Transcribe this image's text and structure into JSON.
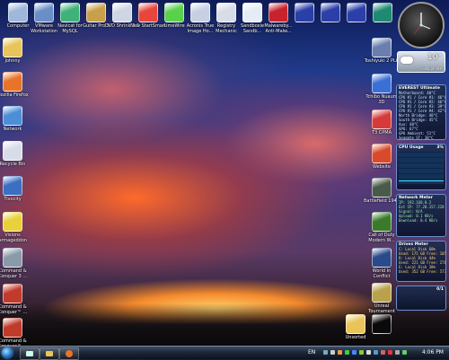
{
  "desktop": {
    "top_icons": [
      {
        "label": "Computer",
        "icon": "computer-icon",
        "color": "#9fb7d8"
      },
      {
        "label": "VMware Workstation",
        "icon": "vmware-icon",
        "color": "#6a8fc6"
      },
      {
        "label": "Navicat for MySQL",
        "icon": "navicat-icon",
        "color": "#3fb27a"
      },
      {
        "label": "Guitar Pro 5",
        "icon": "guitar-pro-icon",
        "color": "#c9a04a"
      },
      {
        "label": "DVD Shrink 3.2",
        "icon": "dvd-shrink-icon",
        "color": "#cfd6e3"
      },
      {
        "label": "New StartSmart",
        "icon": "startsmart-icon",
        "color": "#e8463c"
      },
      {
        "label": "LimeWire",
        "icon": "limewire-icon",
        "color": "#5ad14b"
      },
      {
        "label": "Acronis True Image Ho...",
        "icon": "acronis-icon",
        "color": "#c7d0e2"
      },
      {
        "label": "Registry Mechanic",
        "icon": "registry-mechanic-icon",
        "color": "#d8dce6"
      },
      {
        "label": "Sandboxie Sandb...",
        "icon": "sandboxie-icon",
        "color": "#e6ecf5"
      },
      {
        "label": "Malwareby... Anti-Malw...",
        "icon": "malwarebytes-icon",
        "color": "#c8232c"
      },
      {
        "label": "",
        "icon": "mc-icon",
        "color": "#2b3fa8"
      },
      {
        "label": "",
        "icon": "mc-icon",
        "color": "#2b3fa8"
      },
      {
        "label": "",
        "icon": "mc-icon",
        "color": "#2b3fa8"
      },
      {
        "label": "",
        "icon": "p-app-icon",
        "color": "#1f8a72"
      }
    ],
    "left_icons": [
      {
        "label": "Johnny",
        "icon": "user-folder-icon",
        "color": "#e8c45a"
      },
      {
        "label": "Mozilla Firefox",
        "icon": "firefox-icon",
        "color": "#e8742a"
      },
      {
        "label": "Network",
        "icon": "network-icon",
        "color": "#4d8fd6"
      },
      {
        "label": "Recycle Bin",
        "icon": "recycle-bin-icon",
        "color": "#d7dde8"
      },
      {
        "label": "Tivocity",
        "icon": "tivocity-icon",
        "color": "#3a6fc2"
      },
      {
        "label": "Visions Armageddon",
        "icon": "radiation-icon",
        "color": "#e8d13a"
      },
      {
        "label": "Command & Conquer 3 ...",
        "icon": "cnc-icon",
        "color": "#8a9aa8"
      },
      {
        "label": "Command & Conquer™ ...",
        "icon": "cnc-red-icon",
        "color": "#c23a2a"
      },
      {
        "label": "Command & Conquer™ ...",
        "icon": "cnc-red-icon",
        "color": "#c23a2a"
      }
    ],
    "right_icons": [
      {
        "label": "Toshiyuki 2 PLC",
        "icon": "ts-icon",
        "color": "#6a7fb0"
      },
      {
        "label": "Tchibo Nuaum 3D",
        "icon": "tchibo-icon",
        "color": "#3a6fd6"
      },
      {
        "label": "T3 CPMA",
        "icon": "cpma-icon",
        "color": "#d63a3a"
      },
      {
        "label": "Website",
        "icon": "website-icon",
        "color": "#d84a2a"
      },
      {
        "label": "Battlefield 1942",
        "icon": "battlefield-icon",
        "color": "#4a5a4a"
      },
      {
        "label": "Call of Duty Modern W...",
        "icon": "cod-icon",
        "color": "#3a7a2a"
      },
      {
        "label": "World In Conflict",
        "icon": "wic-icon",
        "color": "#2a4a8a"
      },
      {
        "label": "Unreal Tournament",
        "icon": "ut-icon",
        "color": "#b8a24a"
      },
      {
        "label": "Unsorted",
        "icon": "folder-icon",
        "color": "#e8c45a"
      },
      {
        "label": "",
        "icon": "black-window-icon",
        "color": "#0a0a0a"
      }
    ]
  },
  "gadgets": {
    "weather": {
      "temp": "10°",
      "city": "Skopje, MK"
    },
    "everest": {
      "title": "EVEREST Ultimate",
      "lines": [
        "Motherboard: 40°C",
        "CPU #1 / Core #1: 46°C",
        "CPU #1 / Core #2: 46°C",
        "CPU #1 / Core #3: 39°C",
        "CPU #1 / Core #4: 42°C",
        "North Bridge: 48°C",
        "South Bridge: 45°C",
        "Aux: 40°C",
        "GPU: 67°C",
        "GPU Ambient: 51°C",
        "Seagate ST: 38°C"
      ]
    },
    "cpu": {
      "title": "CPU Usage",
      "value": "3%"
    },
    "network": {
      "title": "Network Meter",
      "lines": [
        "IP: 192.168.0.2",
        "Ext IP: 77.28.157.228",
        "Signal: N/A",
        "Upload: 0.1 KB/s",
        "Download: 0.4 KB/s"
      ]
    },
    "drives": {
      "title": "Drives Meter",
      "lines": [
        "C: Local Disk 60%",
        "Used: 175 GB   Free: 105 GB",
        "D: Local Disk 44%",
        "Used: 221 GB   Free: 278 GB",
        "E: Local Disk 38%",
        "Used: 352 GB   Free: 573 GB"
      ]
    },
    "small": {
      "title": "",
      "value": "0/1"
    }
  },
  "taskbar": {
    "language": "EN",
    "clock": "4:06 PM",
    "quick_launch": [
      "show-desktop-icon",
      "explorer-icon",
      "firefox-icon"
    ]
  }
}
